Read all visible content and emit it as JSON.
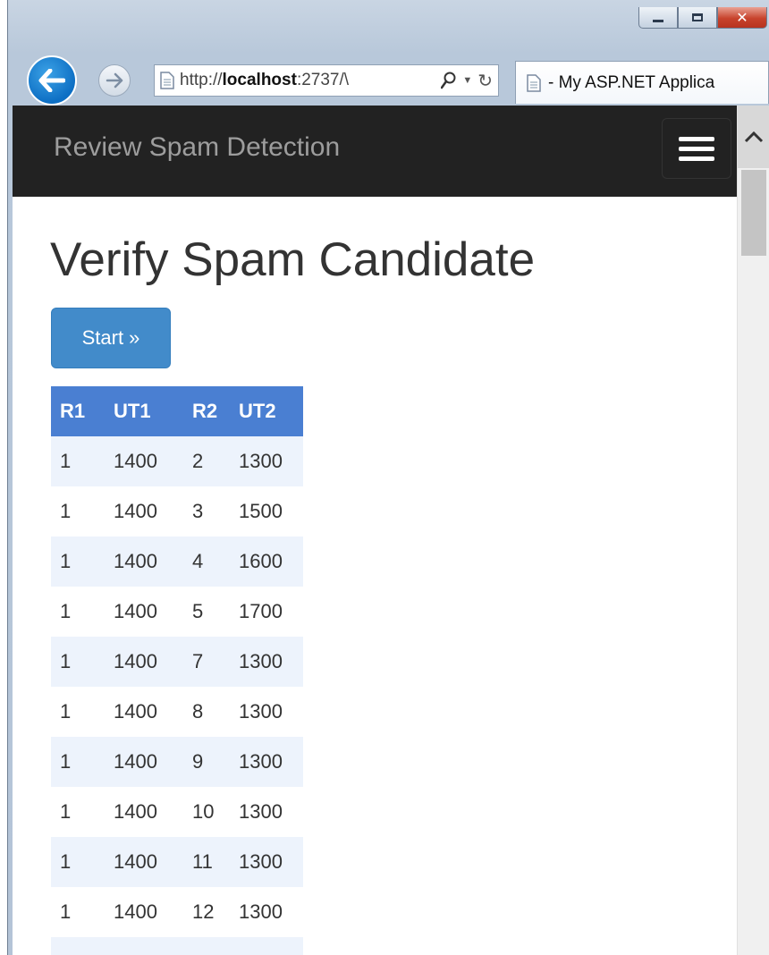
{
  "browser": {
    "address_url_prefix": "http://",
    "address_url_host": "localhost",
    "address_url_rest": ":2737/\\",
    "tab_title": "- My ASP.NET Applica"
  },
  "navbar": {
    "brand": "Review Spam Detection"
  },
  "page": {
    "title": "Verify Spam Candidate",
    "start_button": "Start »"
  },
  "table": {
    "headers": [
      "R1",
      "UT1",
      "R2",
      "UT2"
    ],
    "rows": [
      [
        "1",
        "1400",
        "2",
        "1300"
      ],
      [
        "1",
        "1400",
        "3",
        "1500"
      ],
      [
        "1",
        "1400",
        "4",
        "1600"
      ],
      [
        "1",
        "1400",
        "5",
        "1700"
      ],
      [
        "1",
        "1400",
        "7",
        "1300"
      ],
      [
        "1",
        "1400",
        "8",
        "1300"
      ],
      [
        "1",
        "1400",
        "9",
        "1300"
      ],
      [
        "1",
        "1400",
        "10",
        "1300"
      ],
      [
        "1",
        "1400",
        "11",
        "1300"
      ],
      [
        "1",
        "1400",
        "12",
        "1300"
      ]
    ]
  },
  "colors": {
    "navbar_bg": "#222222",
    "brand_text": "#9d9d9d",
    "primary_button": "#428bca",
    "table_header": "#4a7fd2",
    "row_stripe": "#edf3fc"
  },
  "icons": {
    "back": "back-arrow-icon",
    "forward": "forward-arrow-icon",
    "page": "page-icon",
    "search": "search-icon",
    "refresh": "refresh-icon",
    "menu": "hamburger-icon",
    "scroll_up": "chevron-up-icon"
  }
}
